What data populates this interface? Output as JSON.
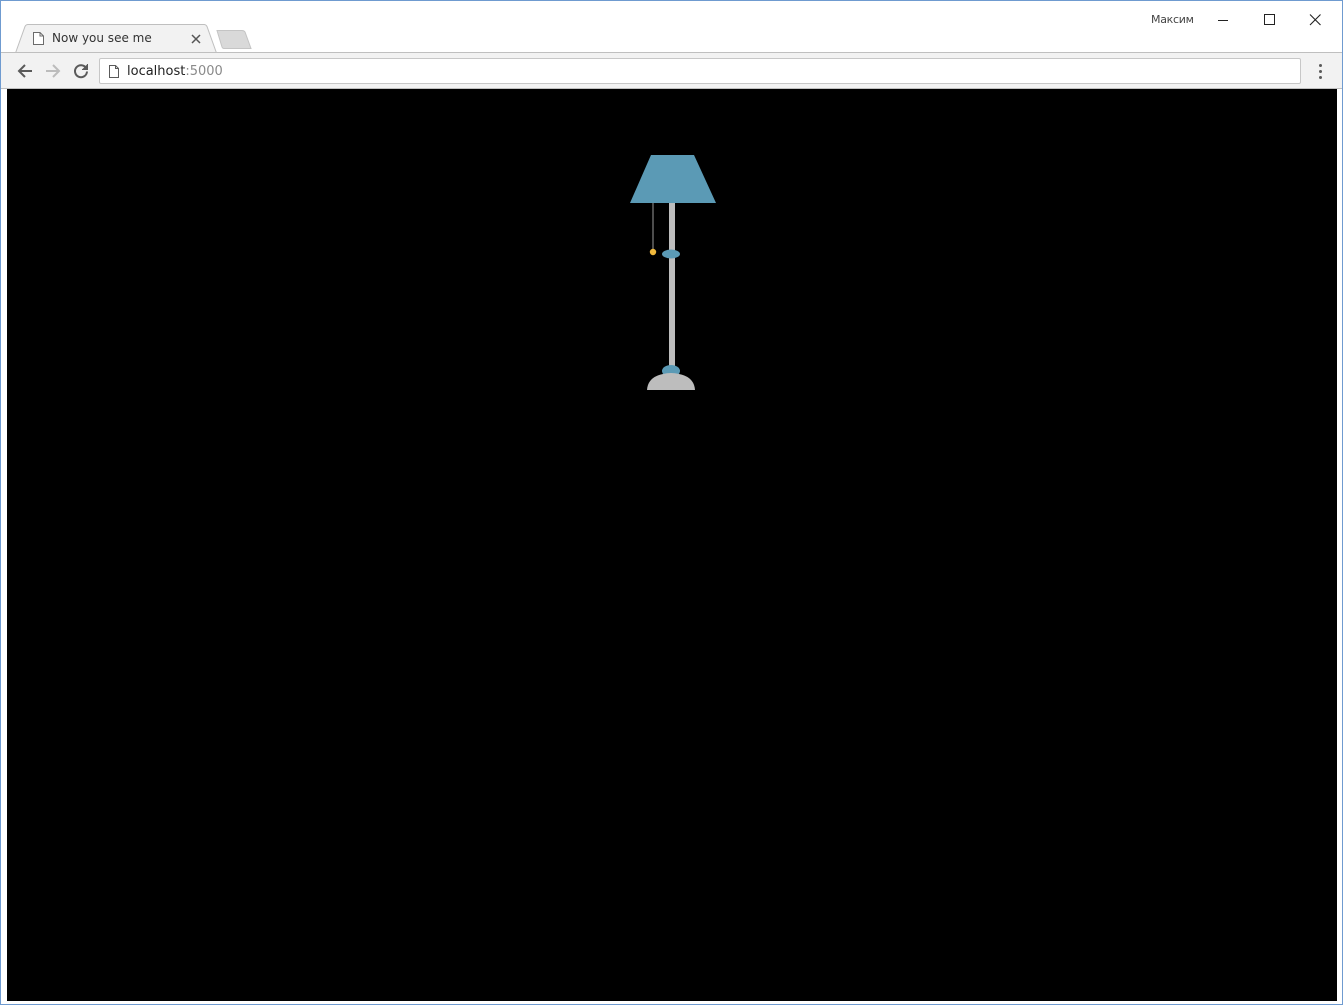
{
  "browser": {
    "profile_name": "Максим",
    "tabs": [
      {
        "title": "Now you see me",
        "active": true
      }
    ],
    "url": {
      "host": "localhost",
      "port_suffix": ":5000"
    },
    "icons": {
      "tab": "page-icon",
      "close": "close-icon",
      "back": "arrow-left-icon",
      "forward": "arrow-right-icon",
      "reload": "reload-icon",
      "menu": "vertical-dots-icon",
      "minimize": "minimize-icon",
      "maximize": "maximize-icon",
      "window_close": "close-icon"
    }
  },
  "page": {
    "background": "#000000",
    "lamp": {
      "shade_color": "#5b9ab5",
      "pole_color": "#bdbdbd",
      "base_color": "#bdbdbd",
      "joint_color": "#5b9ab5",
      "pull_cord_knob_color": "#f0b93c",
      "state": "off"
    }
  }
}
